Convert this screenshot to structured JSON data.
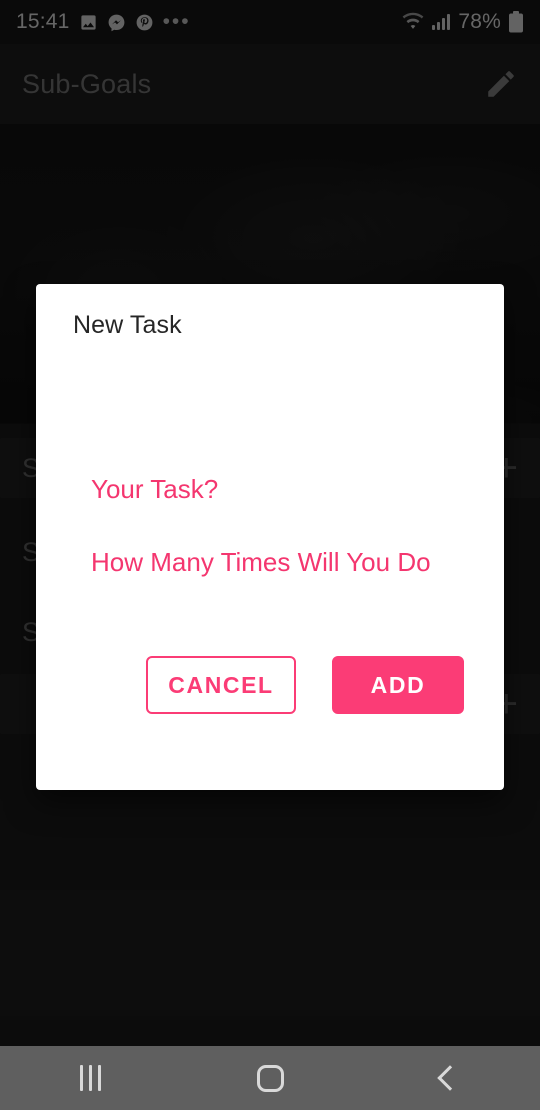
{
  "status_bar": {
    "clock": "15:41",
    "battery_percent": "78%",
    "left_icons": [
      {
        "name": "gallery-icon",
        "glyph": "image"
      },
      {
        "name": "messenger-icon",
        "glyph": "messenger"
      },
      {
        "name": "pinterest-icon",
        "glyph": "pinterest"
      },
      {
        "name": "more-notifications-icon",
        "glyph": "•••"
      }
    ],
    "right_icons": [
      {
        "name": "wifi-icon",
        "glyph": "wifi"
      },
      {
        "name": "cellular-signal-icon",
        "glyph": "signal"
      },
      {
        "name": "battery-icon",
        "glyph": "battery"
      }
    ]
  },
  "app_bar": {
    "title": "Sub-Goals",
    "edit_icon": "pencil-icon"
  },
  "background": {
    "hero_image_alt": "",
    "rows": [
      {
        "title": "S",
        "action": "+"
      },
      {
        "title": "S",
        "action": "+"
      }
    ],
    "add_symbol": "+"
  },
  "dialog": {
    "title": "New Task",
    "fields": [
      {
        "name": "task-name-input",
        "value": "",
        "placeholder": "Your Task?"
      },
      {
        "name": "task-count-input",
        "value": "",
        "placeholder": "How Many Times Will You Do"
      }
    ],
    "buttons": {
      "cancel_label": "CANCEL",
      "add_label": "ADD"
    }
  },
  "nav_bar": {
    "recents_label": "Recents",
    "home_label": "Home",
    "back_label": "Back"
  },
  "colors": {
    "accent_pink": "#fb3c76",
    "placeholder_pink": "#f4366f",
    "screen_background": "#1b1b1b",
    "dialog_background": "#ffffff",
    "nav_bar_background": "#5f5f5f",
    "status_text": "#d6d6d6",
    "app_bar_title": "#6f6f6f"
  }
}
